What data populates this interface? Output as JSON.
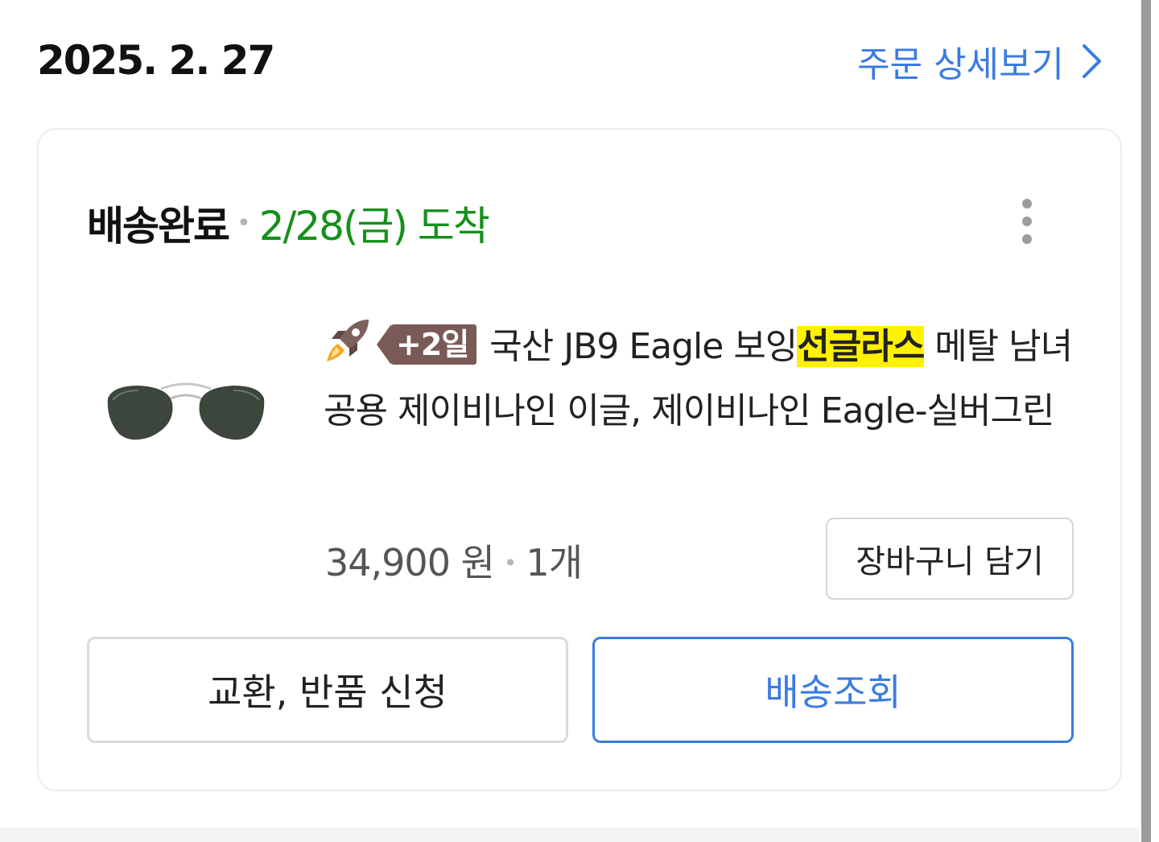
{
  "order": {
    "date": "2025. 2. 27",
    "detail_link": "주문 상세보기"
  },
  "shipment": {
    "status": "배송완료",
    "arrival": "2/28(금) 도착"
  },
  "product": {
    "delivery_badge": "+2일",
    "title_before": "국산 JB9 Eagle 보잉",
    "title_highlight": "선글라스",
    "title_after": " 메탈 남녀공용 제이비나인 이글, 제이비나인 Eagle-실버그린",
    "price": "34,900 원",
    "quantity": "1개"
  },
  "actions": {
    "add_to_cart": "장바구니 담기",
    "exchange_return": "교환, 반품 신청",
    "track_delivery": "배송조회"
  },
  "icons": {
    "detail_arrow": "chevron-right-icon",
    "more": "more-vertical-icon",
    "rocket": "rocket-delivery-icon"
  },
  "colors": {
    "link_blue": "#3a7be2",
    "arrival_green": "#15901a",
    "badge_brown": "#7a5a56",
    "highlight_yellow": "#fff200"
  }
}
